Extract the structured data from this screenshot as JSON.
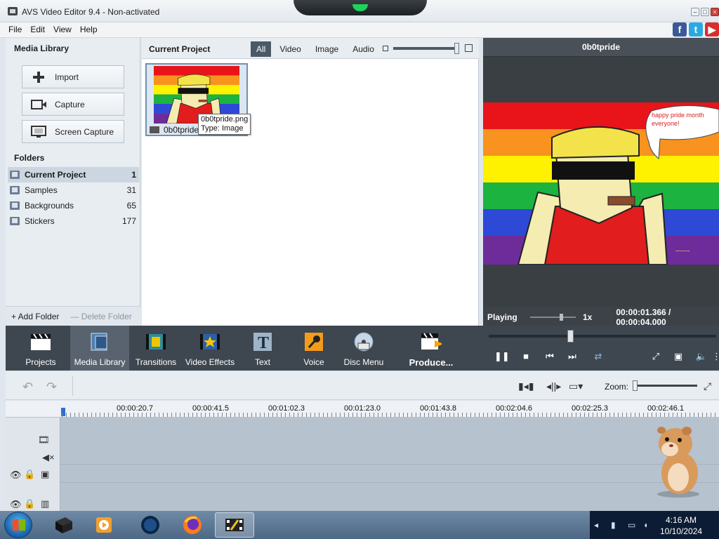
{
  "window": {
    "title": "AVS Video Editor 9.4 - Non-activated",
    "controls": {
      "minimize": "–",
      "restore": "□",
      "close": "×"
    }
  },
  "menu": [
    "File",
    "Edit",
    "View",
    "Help"
  ],
  "social": {
    "facebook": "f",
    "twitter": "t",
    "youtube": "▶"
  },
  "media_library": {
    "title": "Media Library",
    "buttons": [
      {
        "label": "Import",
        "icon": "plus-icon"
      },
      {
        "label": "Capture",
        "icon": "camera-icon"
      },
      {
        "label": "Screen Capture",
        "icon": "screen-capture-icon"
      }
    ],
    "folders_title": "Folders",
    "folders": [
      {
        "name": "Current Project",
        "count": "1",
        "selected": true
      },
      {
        "name": "Samples",
        "count": "31"
      },
      {
        "name": "Backgrounds",
        "count": "65"
      },
      {
        "name": "Stickers",
        "count": "177"
      }
    ],
    "add_folder": "+ Add Folder",
    "delete_folder": "— Delete Folder"
  },
  "project": {
    "title": "Current Project",
    "filters": [
      "All",
      "Video",
      "Image",
      "Audio"
    ],
    "active_filter": "All",
    "items": [
      {
        "name": "0b0tpride"
      }
    ],
    "tooltip": {
      "file": "0b0tpride.png",
      "type": "Type: Image"
    }
  },
  "preview": {
    "title": "0b0tpride",
    "speech_bubble": "happy pride month everyone!",
    "status": "Playing",
    "speed": "1x",
    "time": "00:00:01.366  /  00:00:04.000",
    "progress_fraction": 0.34
  },
  "toolbar": [
    {
      "label": "Projects",
      "icon": "clapperboard-icon"
    },
    {
      "label": "Media Library",
      "icon": "media-library-icon",
      "active": true
    },
    {
      "label": "Transitions",
      "icon": "transitions-icon"
    },
    {
      "label": "Video Effects",
      "icon": "video-effects-icon"
    },
    {
      "label": "Text",
      "icon": "text-icon"
    },
    {
      "label": "Voice",
      "icon": "microphone-icon"
    },
    {
      "label": "Disc Menu",
      "icon": "disc-icon"
    },
    {
      "label": "Produce...",
      "icon": "produce-icon"
    }
  ],
  "timeline": {
    "zoom_label": "Zoom:",
    "ruler": [
      "00:00:20.7",
      "00:00:41.5",
      "00:01:02.3",
      "00:01:23.0",
      "00:01:43.8",
      "00:02:04.6",
      "00:02:25.3",
      "00:02:46.1"
    ]
  },
  "taskbar": {
    "time": "4:16 AM",
    "date": "10/10/2024"
  },
  "colors": {
    "accent": "#2a6fd6",
    "toolbar_bg": "#3e464f",
    "active_filter": "#4a5966"
  }
}
